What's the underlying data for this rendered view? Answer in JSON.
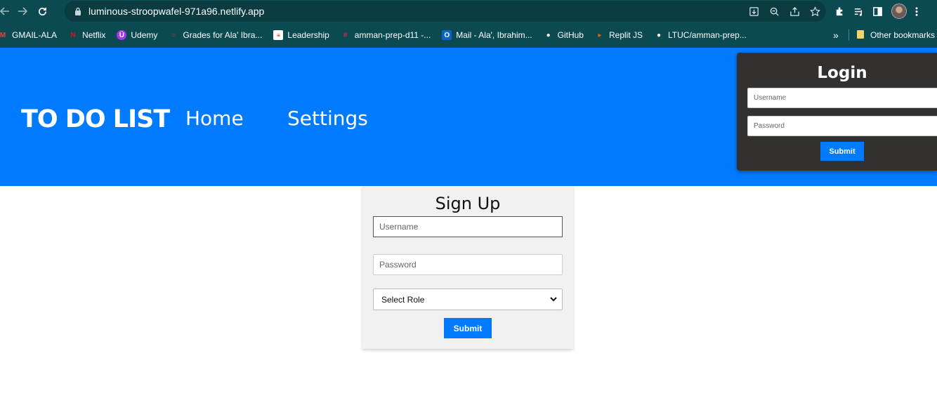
{
  "browser": {
    "url": "luminous-stroopwafel-971a96.netlify.app",
    "bookmarks": [
      {
        "label": "GMAIL-ALA",
        "icon": "gmail-icon",
        "color": "#ea4335"
      },
      {
        "label": "Netflix",
        "icon": "netflix-icon",
        "color": "#e50914"
      },
      {
        "label": "Udemy",
        "icon": "udemy-icon",
        "color": "#a435f0"
      },
      {
        "label": "Grades for Ala' Ibra...",
        "icon": "grades-icon",
        "color": "#e0332f"
      },
      {
        "label": "Leadership",
        "icon": "leadership-icon",
        "color": "#ffffff"
      },
      {
        "label": "amman-prep-d11 -...",
        "icon": "slack-icon",
        "color": "#e01e5a"
      },
      {
        "label": "Mail - Ala', Ibrahim...",
        "icon": "outlook-icon",
        "color": "#0a64c8"
      },
      {
        "label": "GitHub",
        "icon": "github-icon",
        "color": "#ffffff"
      },
      {
        "label": "Replit JS",
        "icon": "replit-icon",
        "color": "#f26207"
      },
      {
        "label": "LTUC/amman-prep...",
        "icon": "github-icon",
        "color": "#ffffff"
      }
    ],
    "more": "»",
    "other_bookmarks": "Other bookmarks"
  },
  "header": {
    "brand": "TO DO LIST",
    "nav": [
      "Home",
      "Settings"
    ]
  },
  "login": {
    "title": "Login",
    "username_placeholder": "Username",
    "password_placeholder": "Password",
    "submit": "Submit"
  },
  "signup": {
    "title": "Sign Up",
    "username_placeholder": "Username",
    "password_placeholder": "Password",
    "role_selected": "Select Role",
    "submit": "Submit"
  },
  "colors": {
    "accent": "#007bff",
    "chrome": "#0b4a50",
    "login_card": "#333130",
    "signup_card": "#f1f1f1"
  }
}
